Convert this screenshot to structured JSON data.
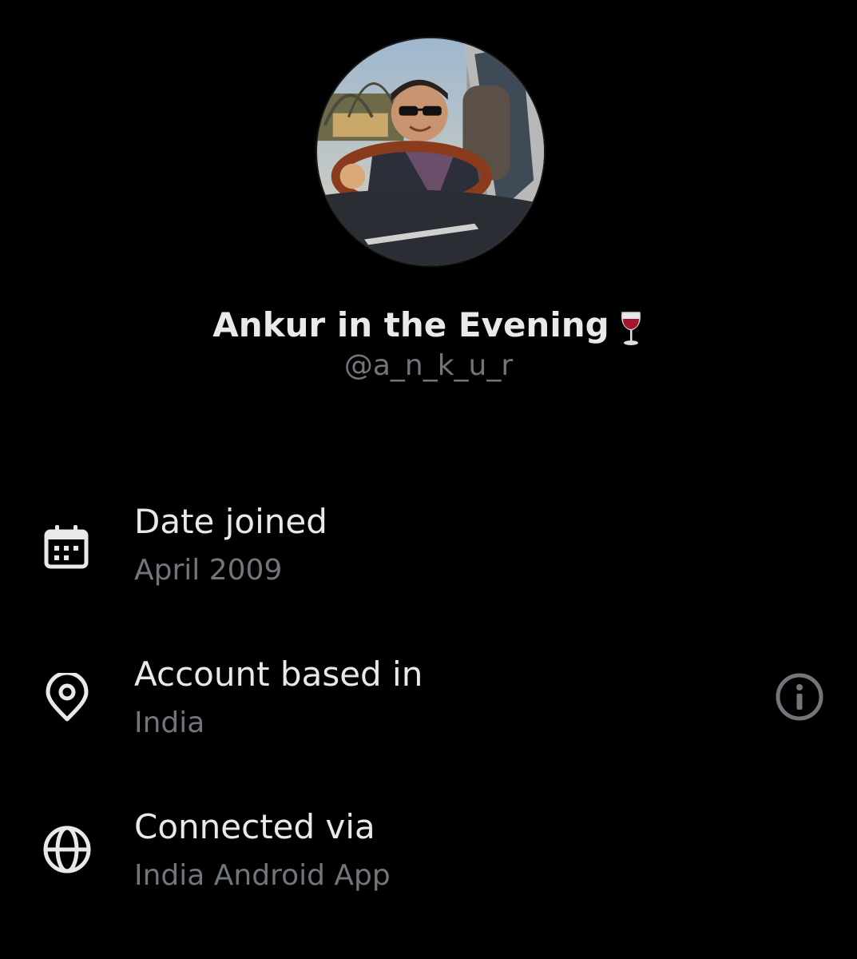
{
  "profile": {
    "display_name": "Ankur in the Evening",
    "name_emoji": "wine-glass-icon",
    "handle": "@a_n_k_u_r"
  },
  "about": {
    "date_joined": {
      "title": "Date joined",
      "value": "April 2009",
      "icon": "calendar-icon"
    },
    "account_based_in": {
      "title": "Account based in",
      "value": "India",
      "icon": "location-pin-icon",
      "action_icon": "info-icon"
    },
    "connected_via": {
      "title": "Connected via",
      "value": "India Android App",
      "icon": "globe-icon"
    }
  },
  "colors": {
    "background": "#000000",
    "primary_text": "#e7e9ea",
    "secondary_text": "#71767b"
  }
}
